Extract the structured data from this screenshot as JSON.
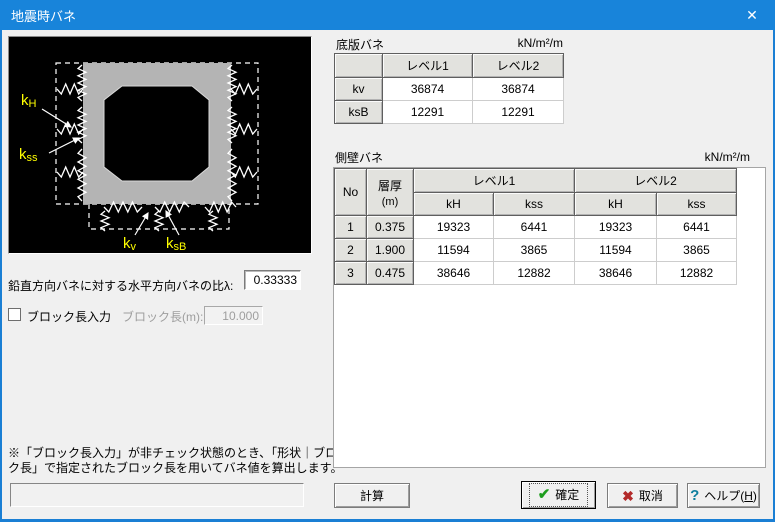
{
  "window": {
    "title": "地震時バネ"
  },
  "icons": {
    "close": "✕",
    "ok_check": "✔",
    "cancel_x": "✖",
    "help_q": "?"
  },
  "diagram": {
    "labels": {
      "kH_main": "k",
      "kH_sub": "H",
      "kss_main": "k",
      "kss_sub": "ss",
      "kv_main": "k",
      "kv_sub": "v",
      "ksB_main": "k",
      "ksB_sub": "sB"
    }
  },
  "ratio": {
    "label": "鉛直方向バネに対する水平方向バネの比λ:",
    "value": "0.33333"
  },
  "block": {
    "checkbox_label": "ブロック長入力",
    "length_label": "ブロック長(m):",
    "length_value": "10.000",
    "checked": false
  },
  "note": {
    "line1": "※「ブロック長入力」が非チェック状態のとき、「形状｜ブロッ",
    "line2": "ク長」で指定されたブロック長を用いてバネ値を算出します。"
  },
  "bottom_table": {
    "title": "底版バネ",
    "unit": "kN/m²/m",
    "col_headers": [
      "レベル1",
      "レベル2"
    ],
    "rows": [
      {
        "label": "kv",
        "level1": "36874",
        "level2": "36874"
      },
      {
        "label": "ksB",
        "level1": "12291",
        "level2": "12291"
      }
    ]
  },
  "wall_table": {
    "title": "側壁バネ",
    "unit": "kN/m²/m",
    "headers": {
      "no": "No",
      "thickness": "層厚",
      "thickness_unit": "(m)",
      "level1": "レベル1",
      "level2": "レベル2",
      "kH": "kH",
      "kss": "kss"
    },
    "rows": [
      [
        "1",
        "0.375",
        "19323",
        "6441",
        "19323",
        "6441"
      ],
      [
        "2",
        "1.900",
        "11594",
        "3865",
        "11594",
        "3865"
      ],
      [
        "3",
        "0.475",
        "38646",
        "12882",
        "38646",
        "12882"
      ]
    ]
  },
  "buttons": {
    "calc": "計算",
    "ok": "確定",
    "cancel": "取消",
    "help_pre": "ヘルプ(",
    "help_key": "H",
    "help_post": ")"
  },
  "colors": {
    "titlebar_blue": "#1884da",
    "diagram_label_yellow": "#ffff00",
    "ok_green": "#1f9e1f",
    "cancel_red": "#b22a2a",
    "help_teal": "#0d7e9e"
  }
}
